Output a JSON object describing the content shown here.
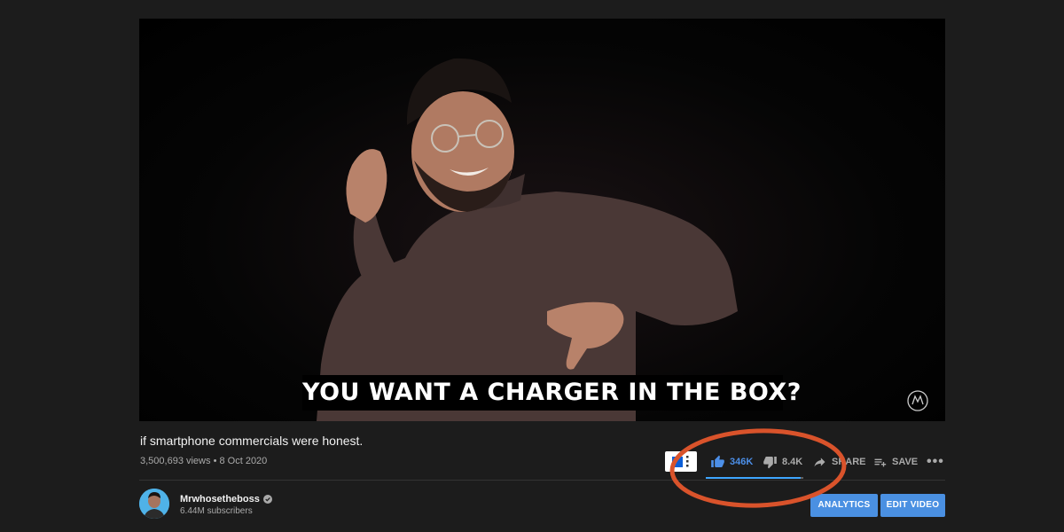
{
  "video": {
    "caption": "YOU WANT A CHARGER IN THE BOX?"
  },
  "info": {
    "title": "if smartphone commercials were honest.",
    "views": "3,500,693 views",
    "date": "8 Oct 2020",
    "meta_separator": "•"
  },
  "actions": {
    "like_count": "346K",
    "dislike_count": "8.4K",
    "share_label": "SHARE",
    "save_label": "SAVE",
    "more_label": "•••",
    "like_ratio": 0.976
  },
  "channel": {
    "name": "Mrwhosetheboss",
    "subscribers": "6.44M subscribers"
  },
  "buttons": {
    "analytics": "ANALYTICS",
    "edit_video": "EDIT VIDEO"
  },
  "colors": {
    "background": "#1c1c1c",
    "accent_blue": "#4a90e2",
    "like_blue": "#4c8fe8",
    "annotation_red": "#d9532b"
  },
  "icons": [
    "clip-icon",
    "thumbs-up-icon",
    "thumbs-down-icon",
    "share-icon",
    "save-playlist-icon",
    "more-icon",
    "verified-icon",
    "watermark-logo-icon"
  ]
}
